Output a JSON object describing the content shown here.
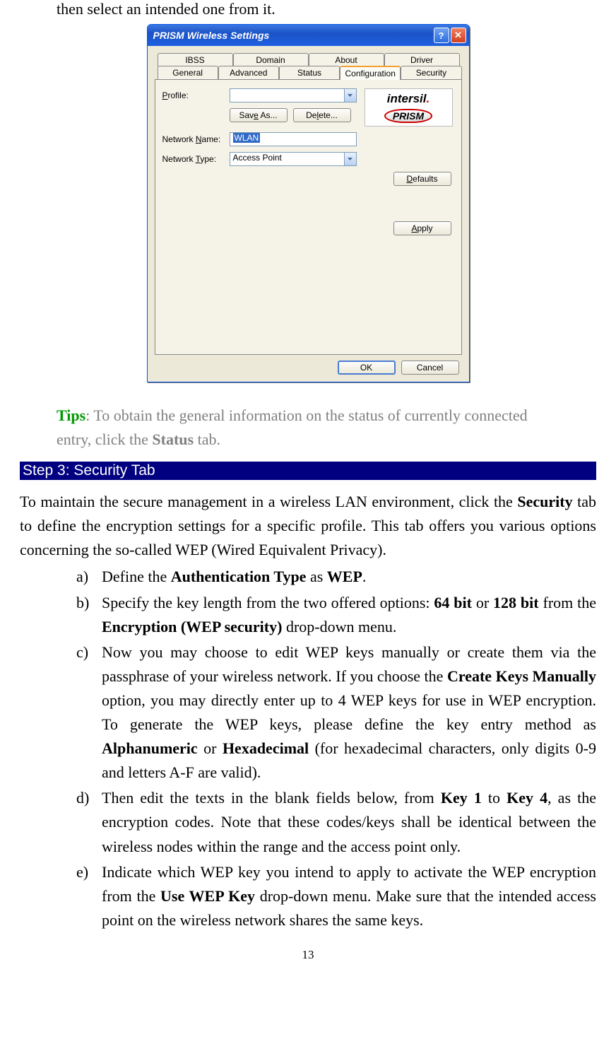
{
  "lead_text": "then select an intended one from it.",
  "dialog": {
    "title": "PRISM Wireless Settings",
    "tabs_row1": [
      "IBSS",
      "Domain",
      "About",
      "Driver"
    ],
    "tabs_row2": [
      "General",
      "Advanced",
      "Status",
      "Configuration",
      "Security"
    ],
    "active_tab": "Configuration",
    "labels": {
      "profile": "rofile:",
      "profile_u": "P",
      "save_as_pre": "Sav",
      "save_as_u": "e",
      "save_as_post": " As...",
      "delete_pre": "De",
      "delete_u": "l",
      "delete_post": "ete...",
      "network_name_pre": "Network ",
      "network_name_u": "N",
      "network_name_post": "ame:",
      "network_type_pre": "Network ",
      "network_type_u": "T",
      "network_type_post": "ype:",
      "defaults_u": "D",
      "defaults_post": "efaults",
      "apply_u": "A",
      "apply_post": "pply",
      "ok": "OK",
      "cancel": "Cancel"
    },
    "network_name_value": "WLAN",
    "network_type_value": "Access Point",
    "logo_text": "intersil",
    "logo_prism": "PRISM"
  },
  "tips": {
    "tips_word": "Tips",
    "text1": ": To obtain the general information on the status of currently connected entry, click the ",
    "status_word": "Status",
    "text2": " tab."
  },
  "step_bar": "Step 3: Security Tab",
  "para": {
    "p1a": "To maintain the secure management in a wireless LAN environment, click the ",
    "p1b": "Security",
    "p1c": " tab to define the encryption settings for a specific profile. This tab offers you various options concerning the so-called WEP (Wired Equivalent Privacy)."
  },
  "items": {
    "a": {
      "t1": "Define the ",
      "b1": "Authentication Type",
      "t2": " as ",
      "b2": "WEP",
      "t3": "."
    },
    "b": {
      "t1": "Specify the key length from the two offered options: ",
      "b1": "64 bit",
      "t2": " or ",
      "b2": "128 bit",
      "t3": " from the ",
      "b3": "Encryption (WEP security)",
      "t4": " drop-down menu."
    },
    "c": {
      "t1": "Now you may choose to edit WEP keys manually or create them via the passphrase of your wireless network. If you choose the ",
      "b1": "Create Keys Manually",
      "t2": " option, you may directly enter up to 4 WEP keys for use in WEP encryption. To generate the WEP keys, please define the key entry method as ",
      "b2": "Alphanumeric",
      "t3": " or ",
      "b3": "Hexadecimal",
      "t4": " (for hexadecimal characters, only digits 0-9 and letters A-F are valid)."
    },
    "d": {
      "t1": "Then edit the texts in the blank fields below, from  ",
      "b1": "Key 1",
      "t2": " to ",
      "b2": "Key 4",
      "t3": ", as the encryption codes. Note that these codes/keys shall be identical between the wireless nodes within the range and the access point only."
    },
    "e": {
      "t1": "Indicate which WEP key you intend to apply to activate the WEP encryption from the ",
      "b1": "Use WEP Key",
      "t2": " drop-down menu. Make sure that the intended access point on the wireless network shares the same keys."
    }
  },
  "page_number": "13"
}
